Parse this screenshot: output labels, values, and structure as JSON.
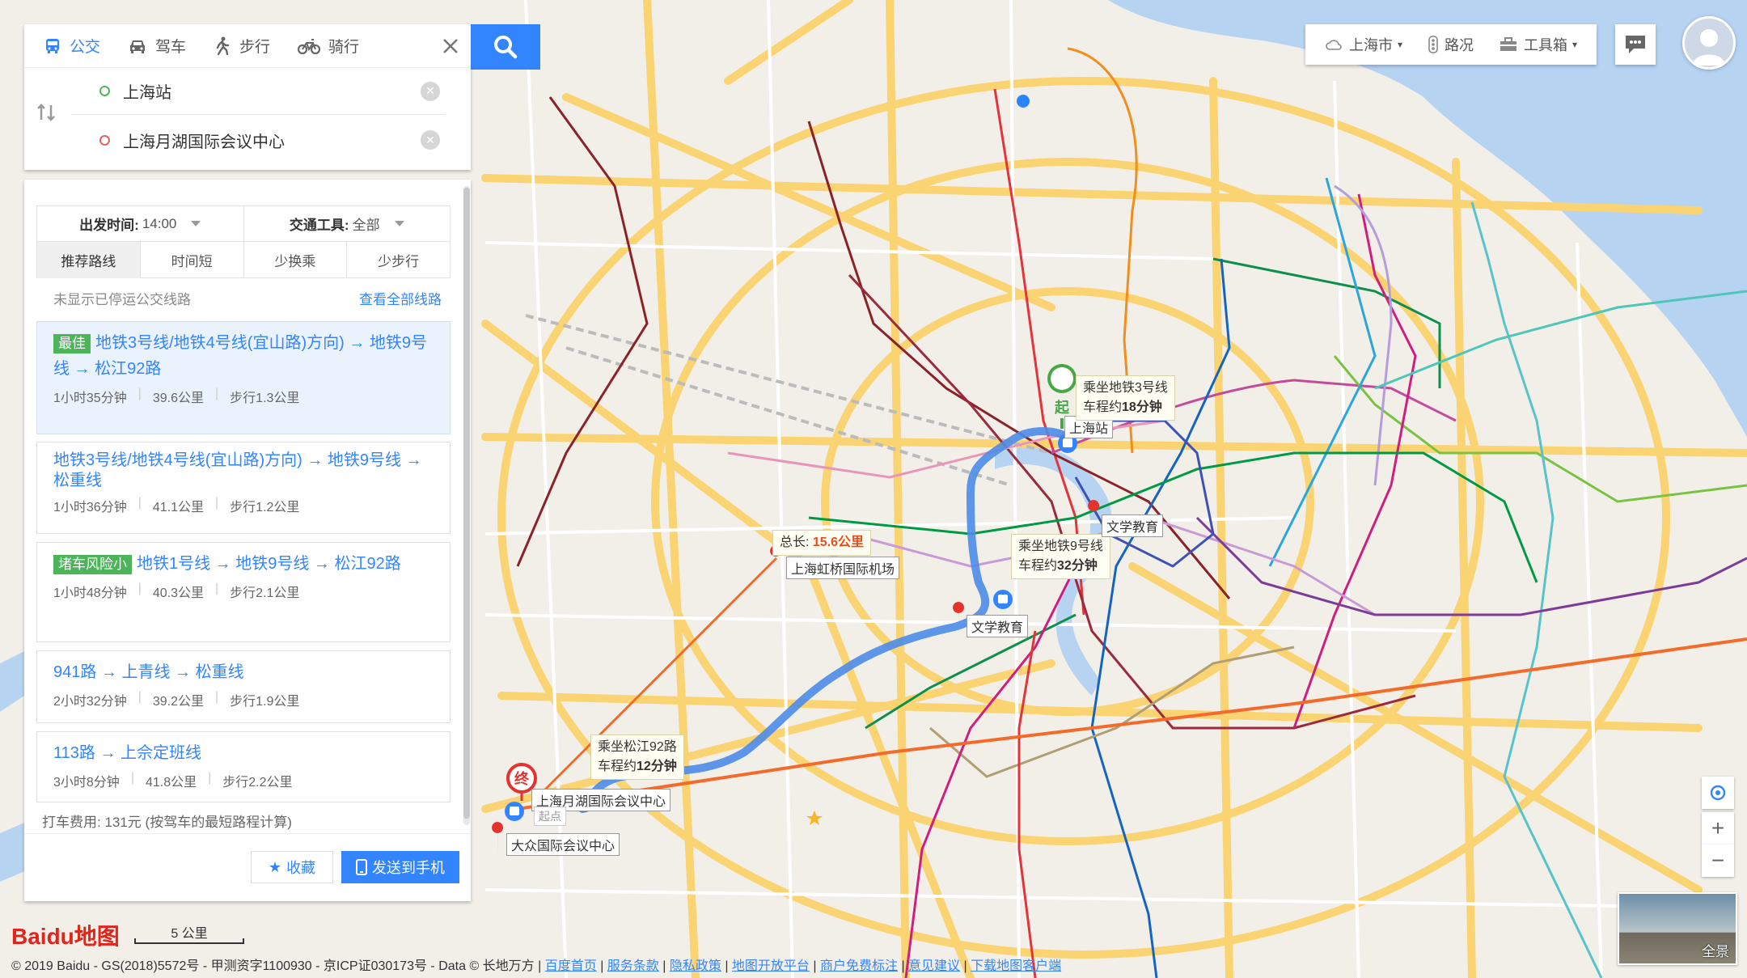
{
  "tabs": [
    {
      "label": "公交",
      "icon": "bus-icon",
      "active": true
    },
    {
      "label": "驾车",
      "icon": "car-icon",
      "active": false
    },
    {
      "label": "步行",
      "icon": "walk-icon",
      "active": false
    },
    {
      "label": "骑行",
      "icon": "bike-icon",
      "active": false
    }
  ],
  "search": {
    "origin": "上海站",
    "destination": "上海月湖国际会议中心"
  },
  "options": {
    "depart_label": "出发时间:",
    "depart_value": "14:00",
    "mode_label": "交通工具:",
    "mode_value": "全部",
    "sort": [
      "推荐路线",
      "时间短",
      "少换乘",
      "少步行"
    ]
  },
  "notice": {
    "text": "未显示已停运公交线路",
    "link": "查看全部线路"
  },
  "routes": [
    {
      "tag": "最佳",
      "tag_color": "#4cb55a",
      "title": "地铁3号线/地铁4号线(宜山路)方向) → 地铁9号线 → 松江92路",
      "duration": "1小时35分钟",
      "distance": "39.6公里",
      "walk": "步行1.3公里"
    },
    {
      "tag": "",
      "title": "地铁3号线/地铁4号线(宜山路)方向) → 地铁9号线 → 松重线",
      "duration": "1小时36分钟",
      "distance": "41.1公里",
      "walk": "步行1.2公里"
    },
    {
      "tag": "堵车风险小",
      "tag_color": "#4cb55a",
      "title": "地铁1号线 → 地铁9号线 → 松江92路",
      "duration": "1小时48分钟",
      "distance": "40.3公里",
      "walk": "步行2.1公里"
    },
    {
      "tag": "",
      "title": "941路 → 上青线 → 松重线",
      "duration": "2小时32分钟",
      "distance": "39.2公里",
      "walk": "步行1.9公里"
    },
    {
      "tag": "",
      "title": "113路 → 上佘定班线",
      "duration": "3小时8分钟",
      "distance": "41.8公里",
      "walk": "步行2.2公里"
    }
  ],
  "taxi": "打车费用: 131元 (按驾车的最短路程计算)",
  "buttons": {
    "favorite": "收藏",
    "send": "发送到手机"
  },
  "topbar": {
    "city": "上海市",
    "traffic": "路况",
    "tools": "工具箱"
  },
  "map_labels": {
    "start_station": "上海站",
    "tip1_line1": "乘坐地铁3号线",
    "tip1_line2": "车程约",
    "tip1_time": "18分钟",
    "total_prefix": "总长:",
    "total_value": "15.6公里",
    "airport": "上海虹桥国际机场",
    "tip2_line1": "乘坐地铁9号线",
    "tip2_line2": "车程约",
    "tip2_time": "32分钟",
    "poi_edu1": "文学教育",
    "poi_edu2": "文学教育",
    "tip3_line1": "乘坐松江92路",
    "tip3_line2": "车程约",
    "tip3_time": "12分钟",
    "dest": "上海月湖国际会议中心",
    "dest_sub": "起点",
    "dazhong": "大众国际会议中心",
    "start_marker": "起",
    "end_marker": "终"
  },
  "scale": "5 公里",
  "logo": "Baidu地图",
  "pano_label": "全景",
  "copyright_prefix": "© 2019 Baidu - GS(2018)5572号 - 甲测资字1100930 - 京ICP证030173号 - Data © 长地万方 |",
  "footer_links": [
    "百度首页",
    "服务条款",
    "隐私政策",
    "地图开放平台",
    "商户免费标注",
    "意见建议",
    "下载地图客户端"
  ]
}
